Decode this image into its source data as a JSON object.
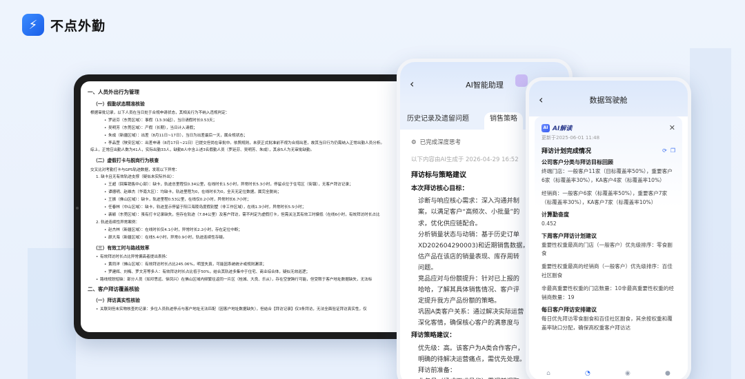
{
  "brand": {
    "name": "不点外勤",
    "logo_glyph": "⚡"
  },
  "tablet": {
    "lines": [
      {
        "kind": "h1",
        "text": "一、人员外出行为管理"
      },
      {
        "kind": "h2",
        "text": "（一）假勤状态精准核验"
      },
      {
        "kind": "p",
        "text": "根据审批记录，以下人员在当日处于合规申请状态，其相关行为不纳入违规判定："
      },
      {
        "kind": "li2",
        "text": "罗廷芬（东莞区域）：事假（13:30起），当日请假时长0.53天；"
      },
      {
        "kind": "li2",
        "text": "吴明芳（东莞区域）：产假（长期），当日计入请假；"
      },
      {
        "kind": "li2",
        "text": "朱成（新疆区域）：出差（8月11日~17日），当日为出差最后一天，属合规状态；"
      },
      {
        "kind": "li2",
        "text": "李品罡（陕安区域）：出差申请（8月17日~21日）已提交但尚在审批中。依照规则，未获正式批准前不视为合规出差，故其当日行为仍需纳入正常出勤人员分析。"
      },
      {
        "kind": "p",
        "text": "综上，正常应出勤人数为41人，实际出勤33人，缺勤8人中含上述3名假勤人员（罗廷芬、吴明芳、朱成），其余5人为无审批缺勤。"
      },
      {
        "kind": "h2",
        "text": "（二）虚假打卡与脱岗行为核查"
      },
      {
        "kind": "p",
        "text": "交叉比对考勤打卡与GPS轨迹数据，发现以下异常："
      },
      {
        "kind": "n",
        "text": "1. 缺卡且无有效轨迹支撑（疑似未实际外出）："
      },
      {
        "kind": "li2",
        "text": "王超（回集销售中心部）：缺卡，轨迹总里程仅0.34公里，在线时长1.5小时，异常时长5.3小时，停留点位于住宅区（街镇），无客户拜访记录；"
      },
      {
        "kind": "li2",
        "text": "谭德明、赵维杰（华南大区）：均缺卡，轨迹里程为0，在线时长为0，全天无定位数据，属完全脱岗；"
      },
      {
        "kind": "li2",
        "text": "王振（佛山区域）：缺卡，轨迹里程0.53公里，在线仅0.2小时，异常时长6.7小时；"
      },
      {
        "kind": "li2",
        "text": "任春林（中山区域）：缺卡，轨迹显示停留于阳江海陵岛度假别墅（非工作区域），在线1.3小时，异常时长5.5小时；"
      },
      {
        "kind": "li2",
        "text": "裴颖（东莞区域）：虽有打卡记录缺失，但存在轨迹（7.84公里）及客户拜访，需不判定为虚假打卡，但需关注其有效工时偏低（在线6小时，有效拜访时长占比"
      },
      {
        "kind": "n",
        "text": "2. 轨迹连续性异常案例："
      },
      {
        "kind": "li2",
        "text": "赵杰林（新疆区域）：在线时长仅4.1小时，异常时长2.2小时，存在定位中断；"
      },
      {
        "kind": "li2",
        "text": "颜大海（新疆区域）：在线5.4小时，异常0.9小时，轨迹连续性存疑。"
      },
      {
        "kind": "h2",
        "text": "（三）有效工时与路线效率"
      },
      {
        "kind": "li",
        "text": "有效拜访时长占比异常偏高者提出表扬："
      },
      {
        "kind": "li2",
        "text": "黄同洋（佛山区域）：有效拜访时长占比245.06%，明显失真，可能因系统统计或规则漏误；"
      },
      {
        "kind": "li2",
        "text": "罗建辉、刘梅、罗文芳等多人：有效拜访时长占比低于50%，结合其轨迹多集中于住宅、商业综合体，疑似无效巡逻；"
      },
      {
        "kind": "li",
        "text": "路线规划短缺：部分人员（如邓思远、徐凤兴）在佛山区域内频繁往返同一片区（桂城、大良、乐从），存在空驶跨行可能，但受限于客户地址数据缺失，无法标"
      },
      {
        "kind": "h1",
        "text": "二、客户拜访覆盖核验"
      },
      {
        "kind": "h2",
        "text": "（一）拜访真实性核验"
      },
      {
        "kind": "li",
        "text": "关联到但未实物核查的记录：多位人员轨迹停点与客户地址无法匹配（因客户地址数据缺失），但结合【拜访记录】仅3条拜访，无法全面验证拜访真实性，仅"
      }
    ]
  },
  "phone1": {
    "title": "AI智能助理",
    "tabs": [
      "历史记录及遗留问题",
      "销售策略"
    ],
    "active_tab": 1,
    "think_label": "已完成深度思考",
    "meta": "以下内容由AI生成于 2026-04-29 16:52",
    "heading": "拜访标与策略建议",
    "goal_label": "本次拜访核心目标：",
    "paras": [
      "诊断与响应核心需求：深入沟通并制",
      "案，以满足客户“高频次、小批量”的",
      "求，优化供应链配合。",
      "分析销量状态与动销：基于历史订单",
      "XD202604290003)和近期销售数据，",
      "估产品在该店的销量表现、库存周转",
      "问题。",
      "竞品应对与份额提升：针对已上报的",
      "哈哈，了解其具体销售情况、客户评",
      "定提升我方产品份额的策略。",
      "巩固A类客户关系：通过解决实际运营",
      "深化客情，确保核心客户的满意度与"
    ],
    "strategy_label": "拜访策略建议：",
    "strategy_paras": [
      "优先级：高。该客户为A类合作客户，",
      "明确的待解决运营痛点，需优先处理。",
      "拜访前准备：",
      "业务员（杨成雨或呈华）需调前调取"
    ]
  },
  "phone2": {
    "title": "数据驾驶舱",
    "ai_label": "AI解读",
    "ai_badge": "AI",
    "updated": "更新于2025-06-01 11:48",
    "section": "拜访计划完成情况",
    "sub1": "公司客户分类与拜访目标回顾",
    "text1": "终端门店：一般客户11家（目标覆盖率50%），重要客户6家（标覆盖率30%），KA客户4家（标覆盖率10%）",
    "text2": "经销商：一般客户6家（标覆盖率50%），重要客户7家（标覆盖率30%），KA客户7家（标覆盖率10%）",
    "sub2": "计算勤奋度",
    "value2": "0.452",
    "sub3": "下周客户拜访计划建议",
    "text3a": "重要性权重最高的门店（一般客户）优先级排序：零食副食",
    "text3b": "重要性权重最高的经销商（一般客户）优先级排序：百佳社区副食",
    "text3c": "非最高重要性权重的门店数量：10非最高重要性权重的经销商数量：19",
    "sub4": "每日客户拜访安排建议",
    "text4": "每日优先拜访零食副食和百佳社区副食，其余按权重和覆盖率缺口分配，确保高权重客户拜访达",
    "nav_icons": [
      "home-icon",
      "chart-icon",
      "chat-icon",
      "user-icon"
    ]
  }
}
